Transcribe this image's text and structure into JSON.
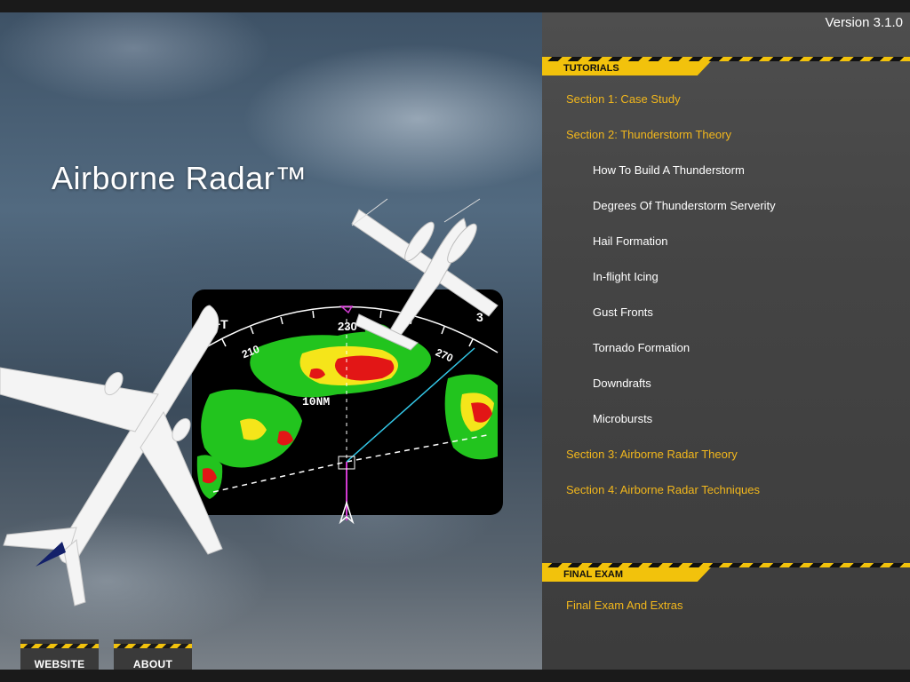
{
  "app": {
    "title": "Airborne Radar™",
    "version": "Version 3.1.0"
  },
  "radar": {
    "heading_labels": [
      "210",
      "230",
      "270",
      "3"
    ],
    "mode_label": "+T",
    "range_label": "10NM"
  },
  "tutorials": {
    "header": "TUTORIALS",
    "items": [
      {
        "label": "Section 1: Case Study",
        "kind": "section"
      },
      {
        "label": "Section 2: Thunderstorm Theory",
        "kind": "section"
      },
      {
        "label": "How To Build A Thunderstorm",
        "kind": "sub"
      },
      {
        "label": "Degrees Of Thunderstorm Serverity",
        "kind": "sub"
      },
      {
        "label": "Hail Formation",
        "kind": "sub"
      },
      {
        "label": "In-flight Icing",
        "kind": "sub"
      },
      {
        "label": "Gust Fronts",
        "kind": "sub"
      },
      {
        "label": "Tornado Formation",
        "kind": "sub"
      },
      {
        "label": "Downdrafts",
        "kind": "sub"
      },
      {
        "label": "Microbursts",
        "kind": "sub"
      },
      {
        "label": "Section 3: Airborne Radar Theory",
        "kind": "section"
      },
      {
        "label": "Section 4: Airborne Radar Techniques",
        "kind": "section"
      }
    ]
  },
  "final_exam": {
    "header": "FINAL EXAM",
    "items": [
      {
        "label": "Final Exam And Extras"
      }
    ]
  },
  "footer": {
    "website_label": "WEBSITE",
    "about_label": "ABOUT"
  },
  "colors": {
    "accent_yellow": "#f2c20c",
    "section_text": "#f2b71c",
    "panel_bg": "#4a4a4a"
  }
}
